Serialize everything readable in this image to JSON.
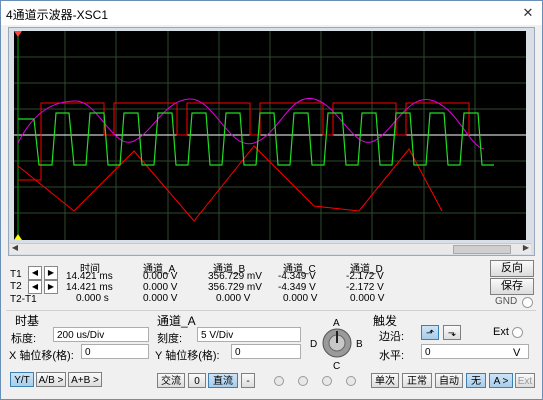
{
  "window": {
    "title": "4通道示波器-XSC1",
    "close_icon": "close-icon"
  },
  "readout": {
    "headers": [
      "时间",
      "通道_A",
      "通道_B",
      "通道_C",
      "通道_D"
    ],
    "rows": [
      {
        "label": "T1",
        "values": [
          "14.421 ms",
          "0.000 V",
          "356.729 mV",
          "-4.349 V",
          "-2.172 V"
        ]
      },
      {
        "label": "T2",
        "values": [
          "14.421 ms",
          "0.000 V",
          "356.729 mV",
          "-4.349 V",
          "-2.172 V"
        ]
      },
      {
        "label": "T2-T1",
        "values": [
          "0.000 s",
          "0.000 V",
          "0.000 V",
          "0.000 V",
          "0.000 V"
        ]
      }
    ]
  },
  "side_buttons": {
    "reverse": "反向",
    "save": "保存",
    "gnd": "GND"
  },
  "timebase": {
    "title": "时基",
    "scale_label": "标度:",
    "scale_value": "200 us/Div",
    "xpos_label": "X 轴位移(格):",
    "xpos_value": "0",
    "buttons": [
      "Y/T",
      "A/B >",
      "A+B >"
    ]
  },
  "channel": {
    "title": "通道_A",
    "scale_label": "刻度:",
    "scale_value": "5  V/Div",
    "ypos_label": "Y 轴位移(格):",
    "ypos_value": "0",
    "buttons": [
      "交流",
      "0",
      "直流",
      "-"
    ],
    "knob_labels": {
      "a": "A",
      "b": "B",
      "c": "C",
      "d": "D"
    }
  },
  "trigger": {
    "title": "触发",
    "edge_label": "边沿:",
    "ext_label": "Ext",
    "level_label": "水平:",
    "level_value": "0",
    "level_unit": "V",
    "buttons": [
      "单次",
      "正常",
      "自动",
      "无",
      "A >",
      "Ext"
    ]
  },
  "colors": {
    "screen_bg": "#000000",
    "channel_a": "#00cc00",
    "channel_b": "#ff00ff",
    "channel_c": "#ff0000",
    "channel_d": "#ffffff"
  }
}
